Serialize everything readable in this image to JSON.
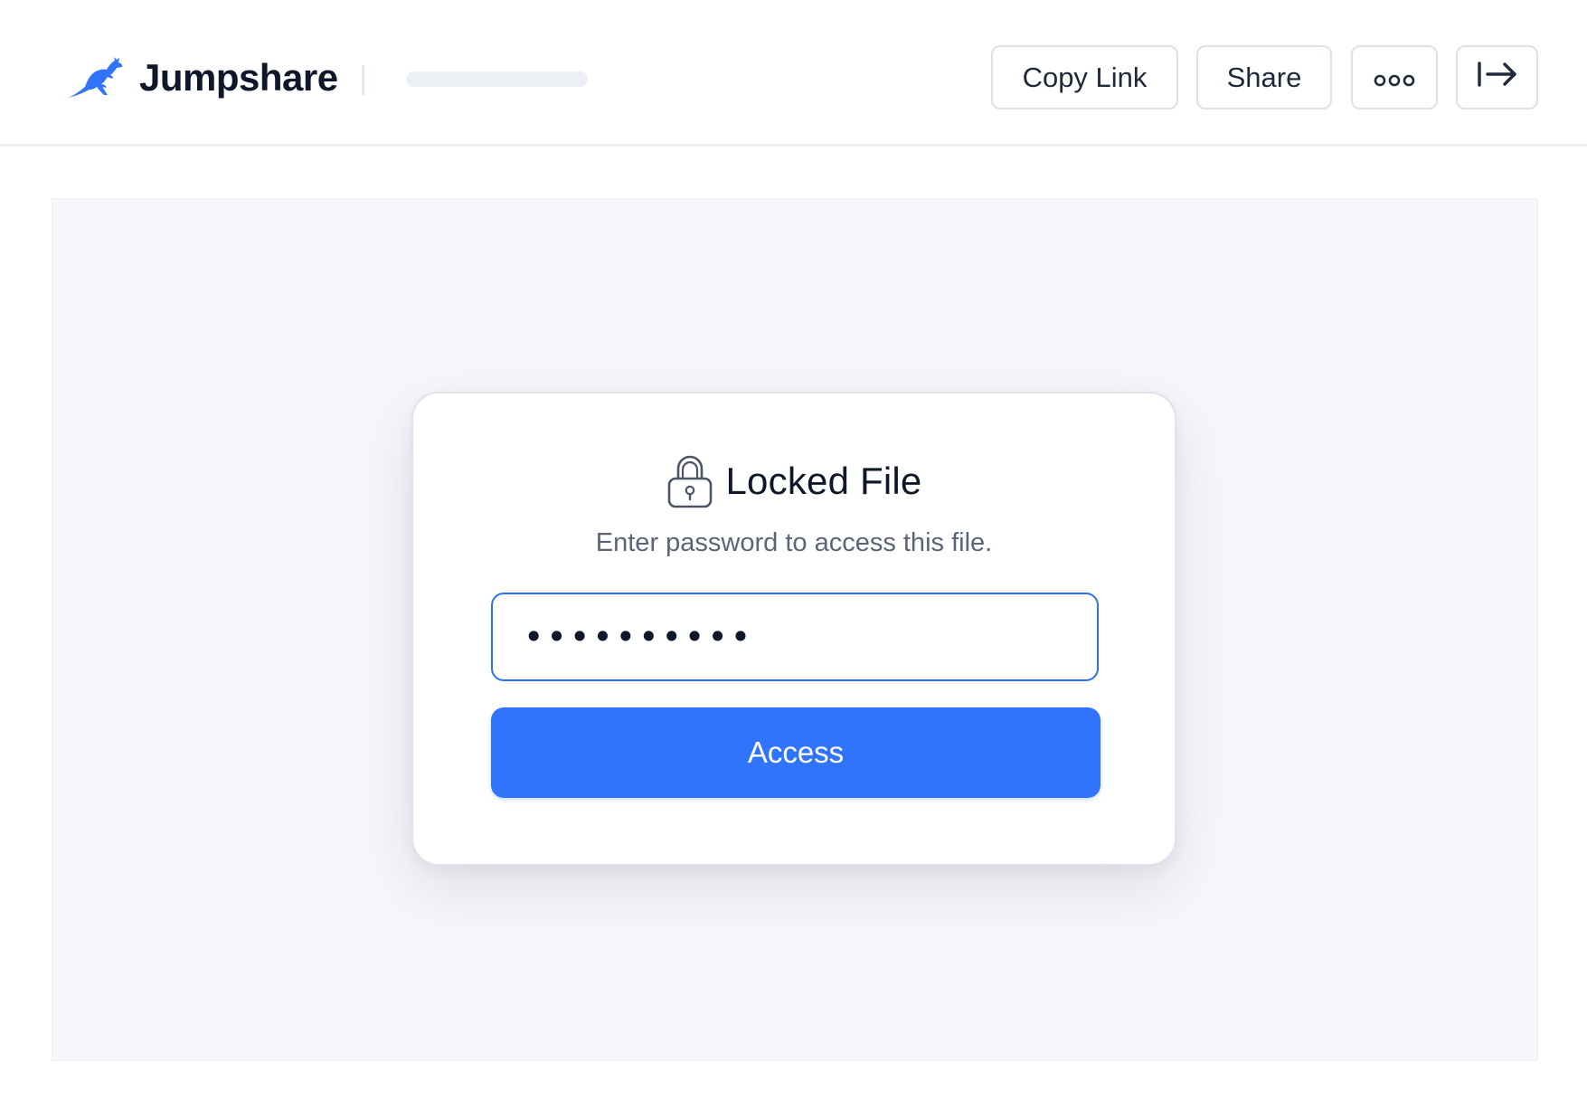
{
  "header": {
    "brand_name": "Jumpshare",
    "brand_color": "#2f74fb",
    "logo_icon": "kangaroo-logo-icon",
    "buttons": {
      "copy_link": "Copy Link",
      "share": "Share",
      "more_icon": "more-dots-icon",
      "exit_icon": "exit-arrow-icon"
    }
  },
  "locked_card": {
    "icon": "lock-icon",
    "title": "Locked File",
    "subtitle": "Enter password to access this file.",
    "password_value": "••••••••••",
    "access_label": "Access",
    "accent_color": "#2f74fb"
  }
}
